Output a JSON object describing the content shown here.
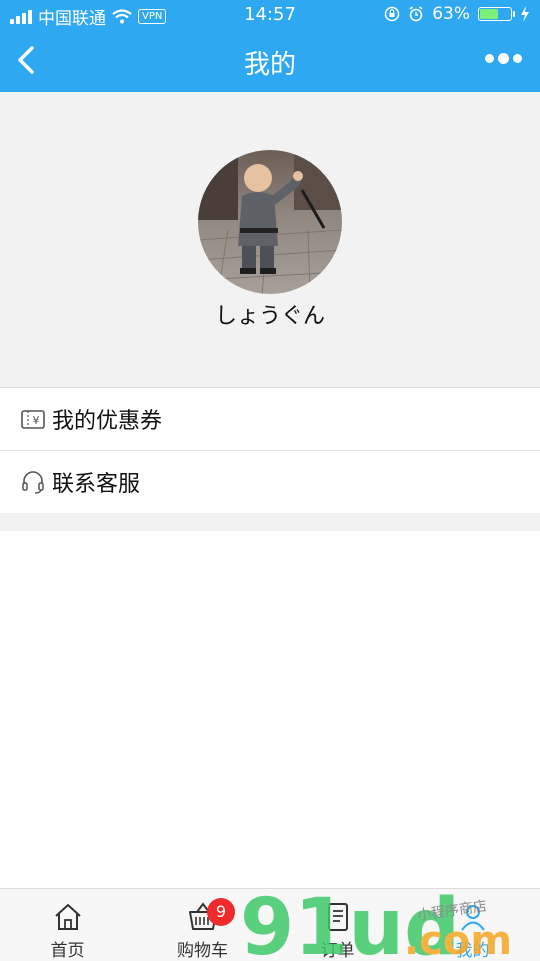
{
  "status_bar": {
    "carrier": "中国联通",
    "vpn": "VPN",
    "time": "14:57",
    "battery": "63%",
    "battery_level": 0.63
  },
  "nav": {
    "title": "我的"
  },
  "profile": {
    "name": "しょうぐん"
  },
  "menu": [
    {
      "label": "我的优惠券",
      "icon": "coupon-icon"
    },
    {
      "label": "联系客服",
      "icon": "headset-icon"
    }
  ],
  "tabs": [
    {
      "label": "首页",
      "icon": "home-icon"
    },
    {
      "label": "购物车",
      "icon": "cart-icon",
      "badge": "9"
    },
    {
      "label": "订单",
      "icon": "order-icon"
    },
    {
      "label": "我的",
      "icon": "profile-icon"
    }
  ],
  "watermark": {
    "brand": "91ud",
    "tld": ".com",
    "tagline": "小程序商店"
  },
  "colors": {
    "primary": "#2fa8f2",
    "badge": "#ef2b2b",
    "watermark_green": "#3fca6a",
    "watermark_orange": "#f5a623"
  }
}
